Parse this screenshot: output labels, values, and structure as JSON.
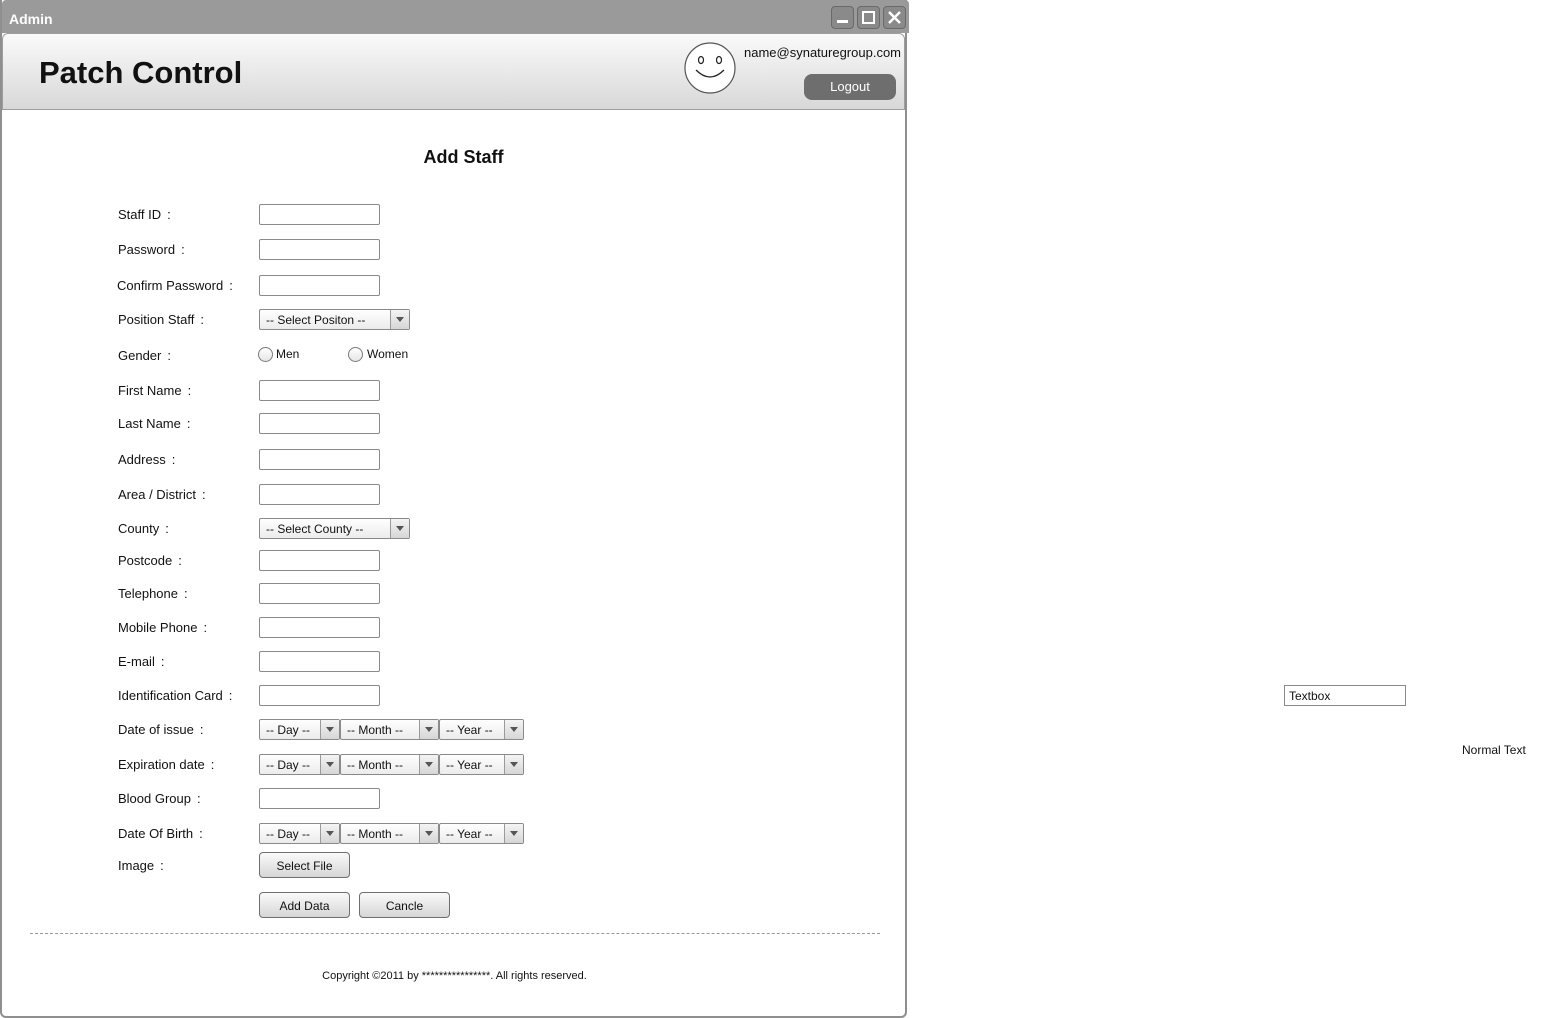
{
  "window": {
    "title": "Admin"
  },
  "header": {
    "app_name": "Patch Control",
    "user_email": "name@synaturegroup.com",
    "logout_label": "Logout",
    "avatar_icon": "smiley-face-icon"
  },
  "form": {
    "title": "Add Staff",
    "colon": ":",
    "labels": {
      "staff_id": "Staff ID",
      "password": "Password",
      "confirm_password": "Confirm Password",
      "position_staff": "Position Staff",
      "gender": "Gender",
      "first_name": "First Name",
      "last_name": "Last Name",
      "address": "Address",
      "area_district": "Area / District",
      "county": "County",
      "postcode": "Postcode",
      "telephone": "Telephone",
      "mobile_phone": "Mobile Phone",
      "email": "E-mail",
      "identification_card": "Identification Card",
      "date_of_issue": "Date of issue",
      "expiration_date": "Expiration date",
      "blood_group": "Blood Group",
      "date_of_birth": "Date Of Birth",
      "image": "Image"
    },
    "position_select": "-- Select Positon --",
    "county_select": "-- Select County --",
    "gender_options": {
      "men": "Men",
      "women": "Women"
    },
    "date_selects": {
      "day": "-- Day --",
      "month": "-- Month --",
      "year": "-- Year --"
    },
    "select_file_label": "Select File",
    "add_data_label": "Add Data",
    "cancel_label": "Cancle"
  },
  "footer": {
    "copyright": "Copyright ©2011 by ****************. All rights reserved."
  },
  "legend": {
    "textbox_label": "Textbox",
    "normal_text_label": "Normal Text"
  }
}
